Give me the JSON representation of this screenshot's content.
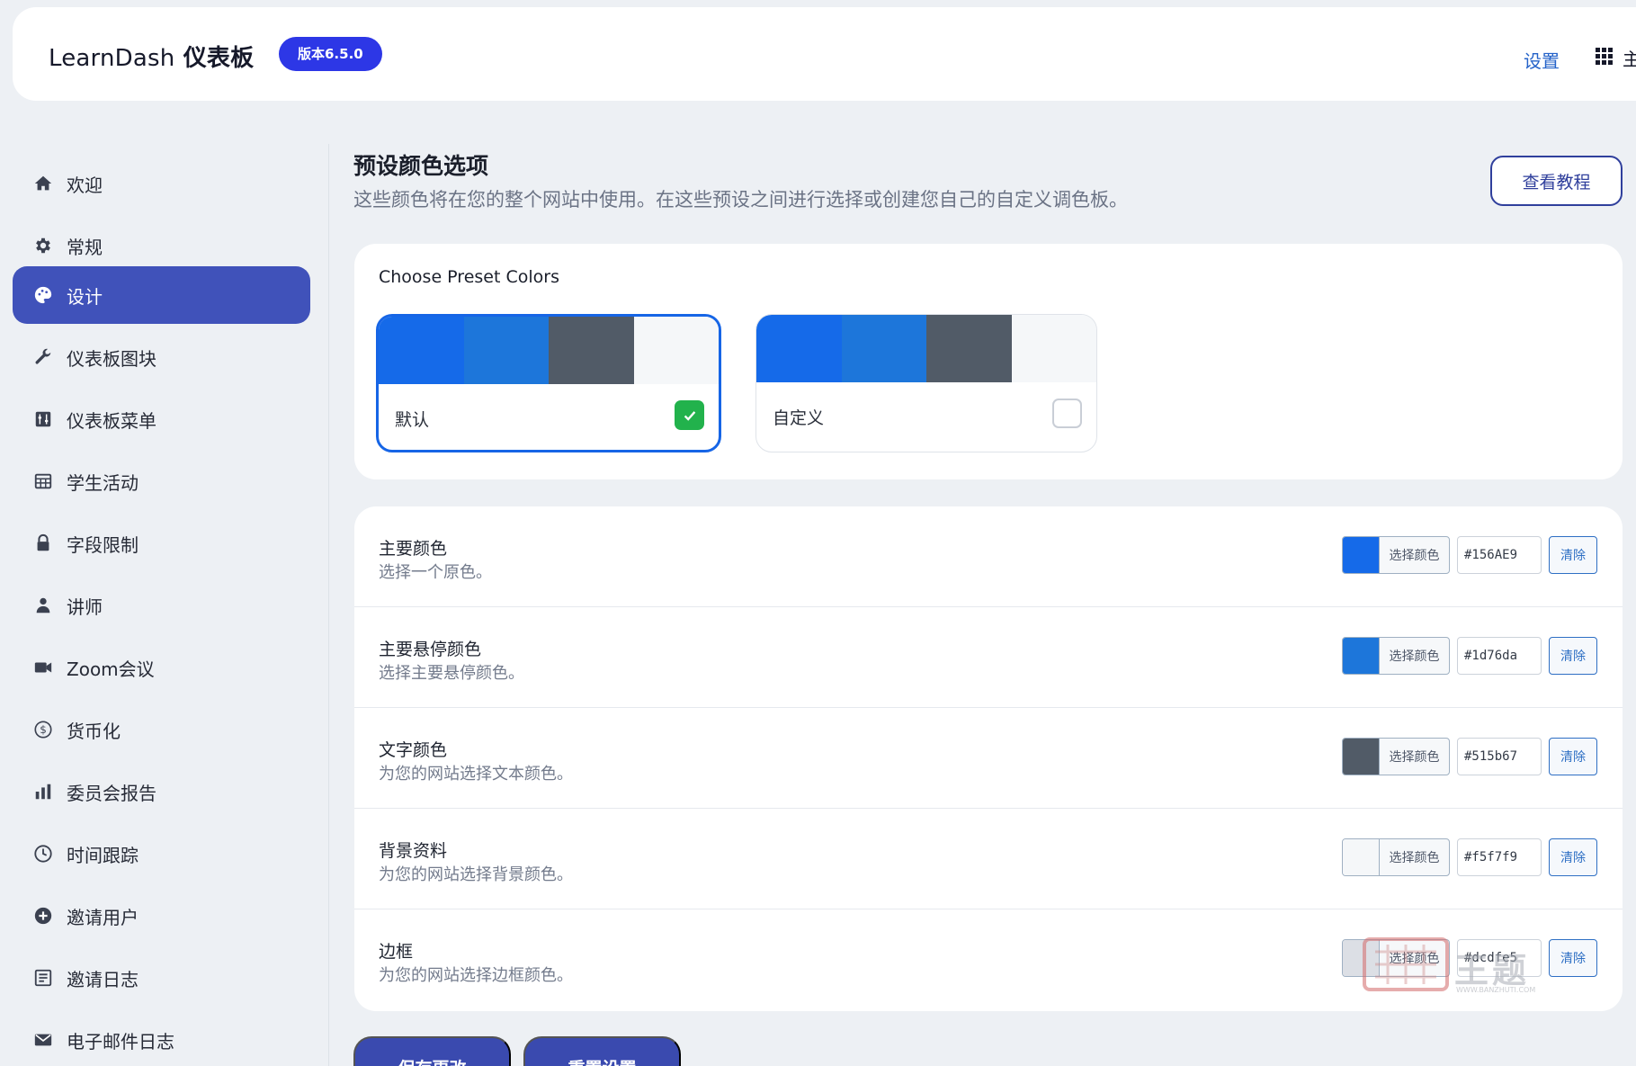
{
  "header": {
    "brand_en": "LearnDash",
    "brand_cn": "仪表板",
    "version_badge": "版本6.5.0",
    "settings_link": "设置",
    "main_link": "主"
  },
  "sidebar": {
    "items": [
      {
        "label": "欢迎",
        "icon": "home-icon"
      },
      {
        "label": "常规",
        "icon": "gear-icon"
      },
      {
        "label": "设计",
        "icon": "palette-icon",
        "active": true
      },
      {
        "label": "仪表板图块",
        "icon": "wrench-icon"
      },
      {
        "label": "仪表板菜单",
        "icon": "sliders-icon"
      },
      {
        "label": "学生活动",
        "icon": "table-icon"
      },
      {
        "label": "字段限制",
        "icon": "lock-icon"
      },
      {
        "label": "讲师",
        "icon": "instructor-icon"
      },
      {
        "label": "Zoom会议",
        "icon": "video-icon"
      },
      {
        "label": "货币化",
        "icon": "dollar-icon"
      },
      {
        "label": "委员会报告",
        "icon": "bar-chart-icon"
      },
      {
        "label": "时间跟踪",
        "icon": "clock-icon"
      },
      {
        "label": "邀请用户",
        "icon": "plus-circle-icon"
      },
      {
        "label": "邀请日志",
        "icon": "log-icon"
      },
      {
        "label": "电子邮件日志",
        "icon": "mail-icon"
      }
    ]
  },
  "main": {
    "title": "预设颜色选项",
    "description": "这些颜色将在您的整个网站中使用。在这些预设之间进行选择或创建您自己的自定义调色板。",
    "tutorial_button": "查看教程",
    "preset": {
      "heading": "Choose Preset Colors",
      "options": [
        {
          "label": "默认",
          "selected": true,
          "swatches": [
            "#156AE9",
            "#1d76da",
            "#515b67",
            "#f5f7f9"
          ]
        },
        {
          "label": "自定义",
          "selected": false,
          "swatches": [
            "#156AE9",
            "#1d76da",
            "#515b67",
            "#f5f7f9"
          ]
        }
      ]
    },
    "colors": [
      {
        "label": "主要颜色",
        "sub": "选择一个原色。",
        "pick": "选择颜色",
        "hex": "#156AE9",
        "clear": "清除",
        "color": "#156AE9"
      },
      {
        "label": "主要悬停颜色",
        "sub": "选择主要悬停颜色。",
        "pick": "选择颜色",
        "hex": "#1d76da",
        "clear": "清除",
        "color": "#1d76da"
      },
      {
        "label": "文字颜色",
        "sub": "为您的网站选择文本颜色。",
        "pick": "选择颜色",
        "hex": "#515b67",
        "clear": "清除",
        "color": "#515b67"
      },
      {
        "label": "背景资料",
        "sub": "为您的网站选择背景颜色。",
        "pick": "选择颜色",
        "hex": "#f5f7f9",
        "clear": "清除",
        "color": "#f5f7f9"
      },
      {
        "label": "边框",
        "sub": "为您的网站选择边框颜色。",
        "pick": "选择颜色",
        "hex": "#dcdfe5",
        "clear": "清除",
        "color": "#dcdfe5"
      }
    ],
    "save_button": "保存更改",
    "reset_button": "重置设置"
  },
  "watermark": {
    "text": "王题",
    "sub": "WWW.BANZHUTI.COM"
  }
}
